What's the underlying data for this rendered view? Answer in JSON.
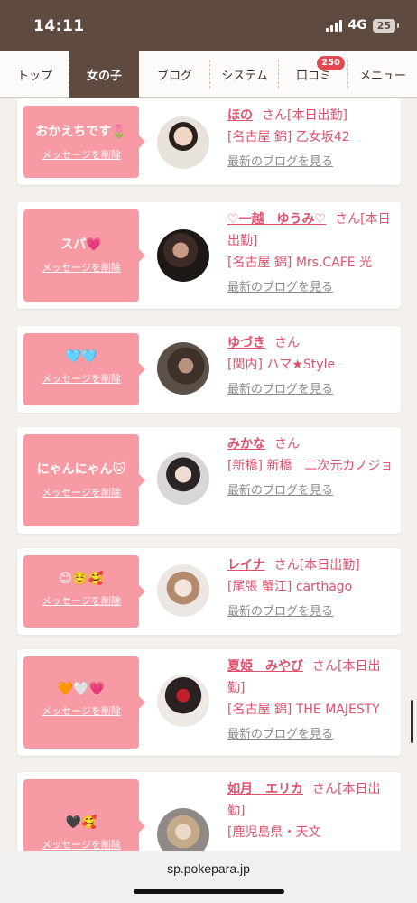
{
  "status": {
    "time": "14:11",
    "network": "4G",
    "battery": "25"
  },
  "nav": {
    "tabs": [
      {
        "label": "トップ"
      },
      {
        "label": "女の子"
      },
      {
        "label": "ブログ"
      },
      {
        "label": "システム"
      },
      {
        "label": "口コミ",
        "badge": "250"
      },
      {
        "label": "メニュー"
      }
    ]
  },
  "common": {
    "delete_label": "メッセージを削除",
    "blog_link": "最新のブログを見る",
    "san": "さん"
  },
  "cards": [
    {
      "message": "おかえちです🌷",
      "name": "ほの",
      "tag": "[本日出勤]",
      "shop": "[名古屋 錦] 乙女坂42"
    },
    {
      "message": "スパ💗",
      "name": "♡一越　ゆうみ♡",
      "tag": "[本日出勤]",
      "shop": "[名古屋 錦] Mrs.CAFE 光"
    },
    {
      "message": "🩵🩵",
      "name": "ゆづき",
      "tag": "",
      "shop": "[関内] ハマ★Style"
    },
    {
      "message": "にゃんにゃん🐱",
      "name": "みかな",
      "tag": "",
      "shop": "[新橋] 新橋　二次元カノジョ"
    },
    {
      "message": "😊☺️🥰",
      "name": "レイナ",
      "tag": "[本日出勤]",
      "shop": "[尾張 蟹江] carthago"
    },
    {
      "message": "🧡🤍💗",
      "name": "夏姫　みやび",
      "tag": "[本日出勤]",
      "shop": "[名古屋 錦] THE MAJESTY"
    },
    {
      "message": "🖤🥰",
      "name": "如月　エリカ",
      "tag": "[本日出勤]",
      "shop": "[鹿児島県・天文"
    }
  ],
  "browser": {
    "url": "sp.pokepara.jp"
  }
}
